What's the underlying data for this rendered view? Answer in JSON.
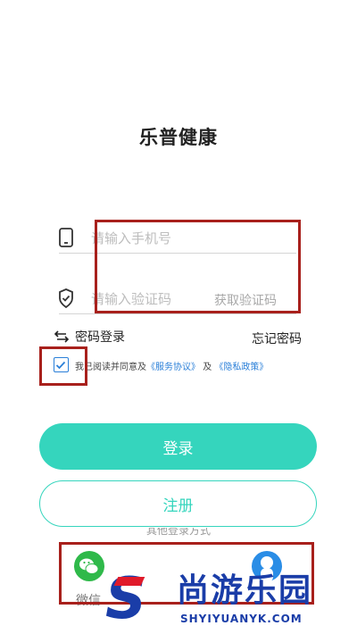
{
  "app": {
    "title": "乐普健康"
  },
  "form": {
    "phone_placeholder": "请输入手机号",
    "code_placeholder": "请输入验证码",
    "get_code_label": "获取验证码"
  },
  "options": {
    "password_login_label": "密码登录",
    "forgot_password_label": "忘记密码"
  },
  "agreement": {
    "prefix": "我已阅读并同意及",
    "service_link": "《服务协议》",
    "conjunction": "及",
    "privacy_link": "《隐私政策》"
  },
  "buttons": {
    "login_label": "登录",
    "register_label": "注册"
  },
  "other_login": {
    "title": "其他登录方式",
    "wechat_label": "微信"
  },
  "watermark": {
    "brand": "尚游乐园",
    "url": "SHYIYUANYK.COM"
  },
  "colors": {
    "accent": "#35d5bd",
    "link": "#2a7fd8",
    "highlight_box": "#a8201c",
    "watermark": "#1a3da8"
  }
}
